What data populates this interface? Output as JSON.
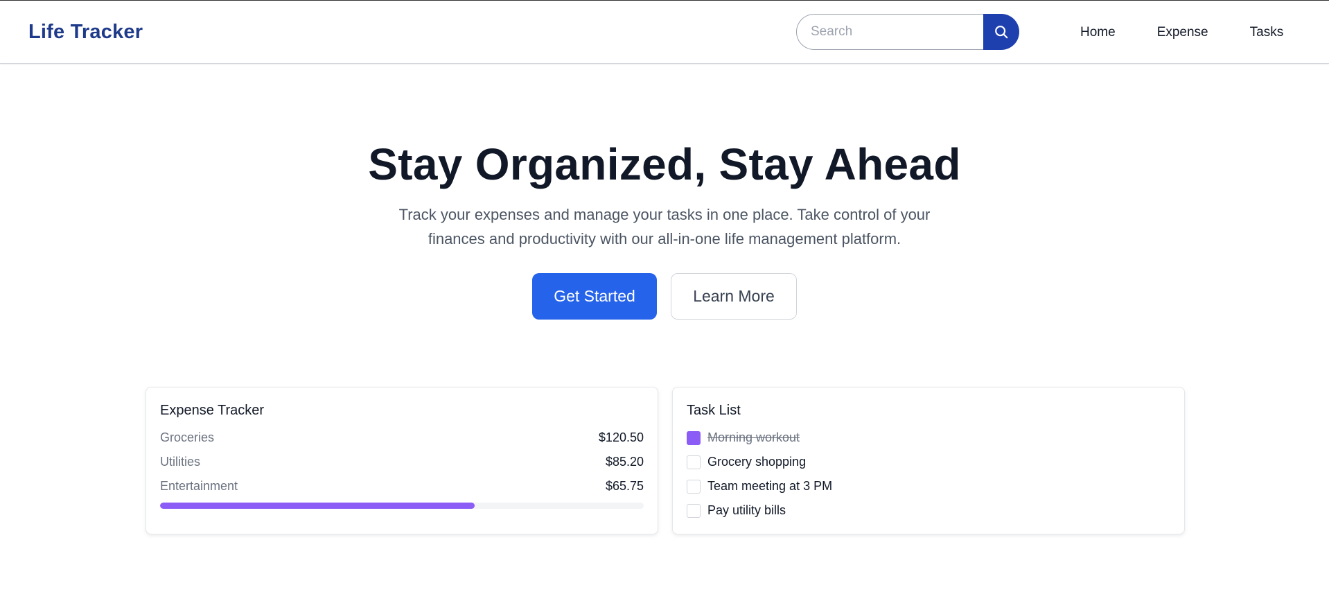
{
  "brand": "Life Tracker",
  "search": {
    "placeholder": "Search",
    "value": ""
  },
  "nav": [
    "Home",
    "Expense",
    "Tasks"
  ],
  "hero": {
    "title": "Stay Organized, Stay Ahead",
    "subtitle": "Track your expenses and manage your tasks in one place. Take control of your finances and productivity with our all-in-one life management platform.",
    "primary_cta": "Get Started",
    "secondary_cta": "Learn More"
  },
  "expense": {
    "title": "Expense Tracker",
    "items": [
      {
        "label": "Groceries",
        "amount": "$120.50"
      },
      {
        "label": "Utilities",
        "amount": "$85.20"
      },
      {
        "label": "Entertainment",
        "amount": "$65.75"
      }
    ],
    "progress_fraction": 0.65
  },
  "tasks": {
    "title": "Task List",
    "items": [
      {
        "text": "Morning workout",
        "done": true
      },
      {
        "text": "Grocery shopping",
        "done": false
      },
      {
        "text": "Team meeting at 3 PM",
        "done": false
      },
      {
        "text": "Pay utility bills",
        "done": false
      }
    ]
  },
  "colors": {
    "brand": "#1e3a8a",
    "search_button": "#1e40af",
    "primary": "#2563eb",
    "accent": "#8b5cf6"
  },
  "icons": {
    "search": "search-icon"
  }
}
